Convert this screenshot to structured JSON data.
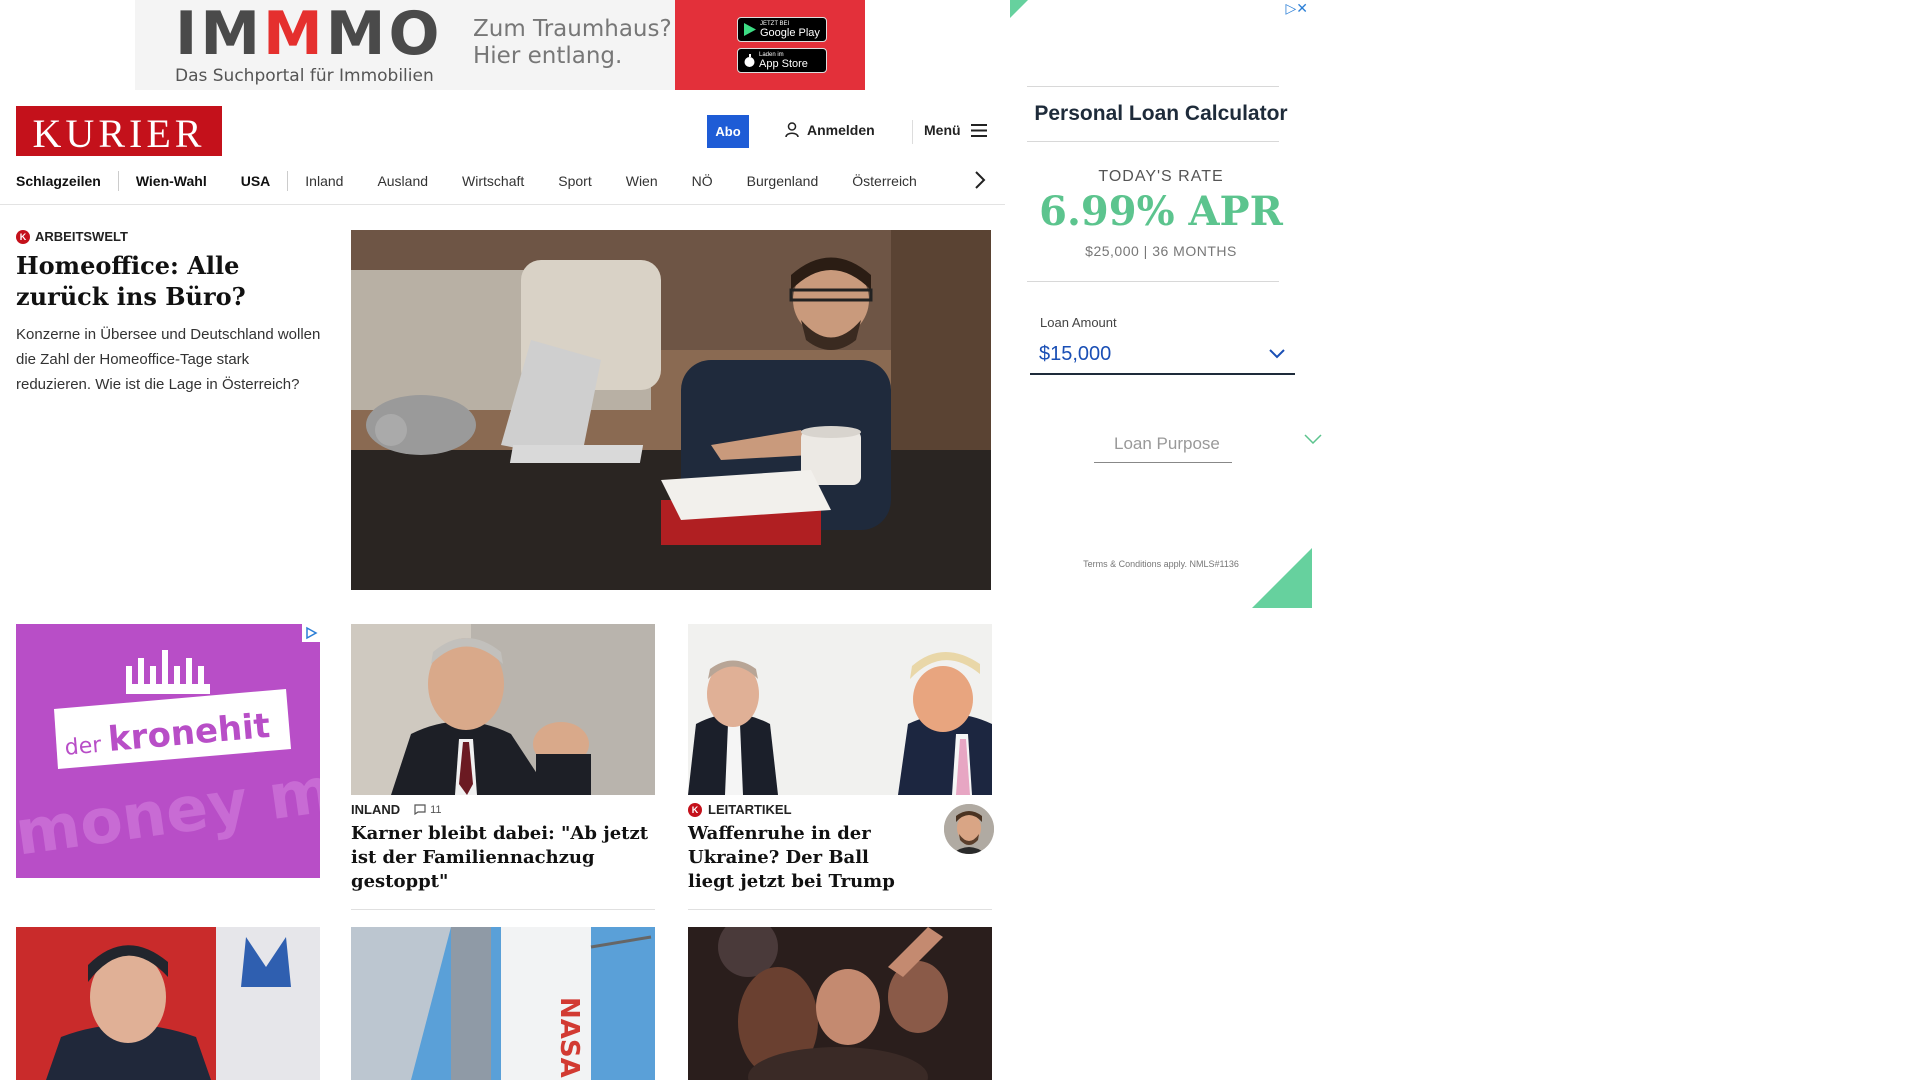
{
  "top_ad": {
    "brand_letters": [
      "IM",
      "M",
      "MO"
    ],
    "subline": "Das Suchportal für Immobilien",
    "claim_line1": "Zum Traumhaus?",
    "claim_line2": "Hier entlang.",
    "google_play": {
      "small": "JETZT BEI",
      "big": "Google Play"
    },
    "app_store": {
      "small": "Laden im",
      "big": "App Store"
    },
    "brand_color": "#e5302e"
  },
  "header": {
    "logo_text": "KURIER",
    "abo_label": "Abo",
    "login_label": "Anmelden",
    "menu_label": "Menü"
  },
  "nav": {
    "items": [
      "Schlagzeilen",
      "Wien-Wahl",
      "USA",
      "Inland",
      "Ausland",
      "Wirtschaft",
      "Sport",
      "Wien",
      "NÖ",
      "Burgenland",
      "Österreich"
    ]
  },
  "hero": {
    "kicker": "ARBEITSWELT",
    "title": "Homeoffice: Alle zurück ins Büro?",
    "lead": "Konzerne in Übersee und Deutschland wollen die Zahl der Homeoffice-Tage stark reduzieren. Wie ist die Lage in Österreich?"
  },
  "mid_ad": {
    "brand_prefix": "der",
    "brand_name": "kronehit",
    "watermark": "money m"
  },
  "cards": [
    {
      "kicker": "INLAND",
      "comments": "11",
      "title": "Karner bleibt dabei: \"Ab jetzt ist der Familiennachzug gestoppt\""
    },
    {
      "kicker": "LEITARTIKEL",
      "title": "Waffenruhe in der Ukraine? Der Ball liegt jetzt bei Trump"
    }
  ],
  "bottom_row": {
    "rocket_text": "NASA"
  },
  "loan_ad": {
    "title": "Personal Loan Calculator",
    "rate_label": "TODAY'S RATE",
    "rate_value": "6.99% APR",
    "rate_sub": "$25,000 | 36 MONTHS",
    "amount_label": "Loan Amount",
    "amount_value": "$15,000",
    "purpose_placeholder": "Loan Purpose",
    "terms": "Terms & Conditions apply. NMLS#1136",
    "accent_color": "#5cc48e"
  },
  "colors": {
    "kurier_red": "#c4111b",
    "abo_blue": "#1e5cd6"
  }
}
